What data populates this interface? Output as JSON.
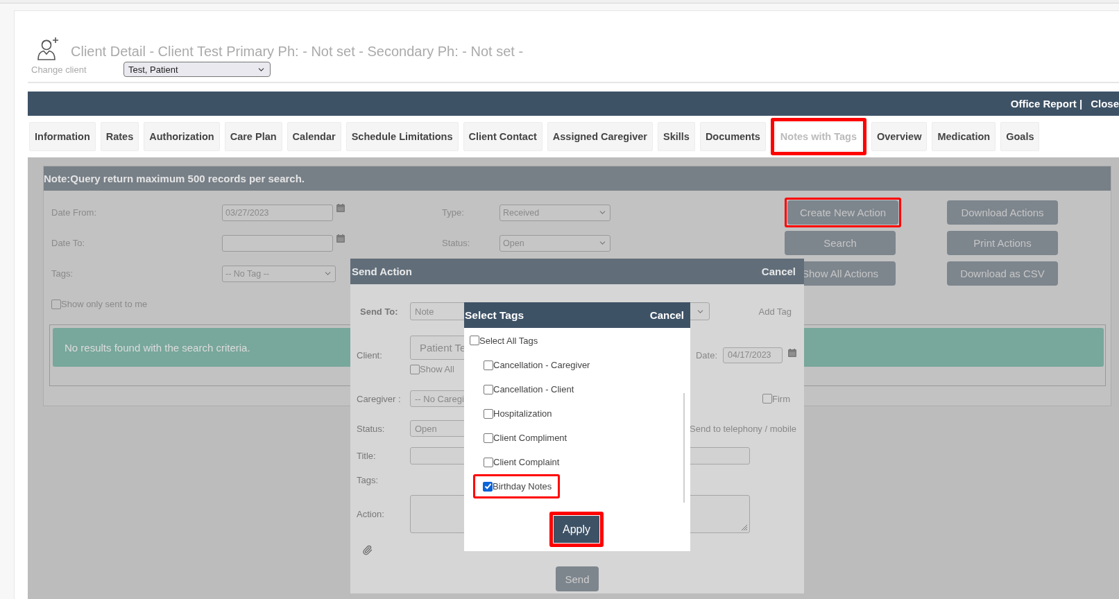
{
  "header": {
    "title": "Client Detail - Client Test Primary Ph: - Not set - Secondary Ph: - Not set -",
    "change_label": "Change client",
    "client_select": "Test, Patient"
  },
  "top_bar": {
    "links": [
      "Office Report |",
      "Close"
    ]
  },
  "tabs": [
    {
      "label": "Information",
      "selected": false,
      "highlighted": false
    },
    {
      "label": "Rates",
      "selected": false,
      "highlighted": false
    },
    {
      "label": "Authorization",
      "selected": false,
      "highlighted": false
    },
    {
      "label": "Care Plan",
      "selected": false,
      "highlighted": false
    },
    {
      "label": "Calendar",
      "selected": false,
      "highlighted": false
    },
    {
      "label": "Schedule Limitations",
      "selected": false,
      "highlighted": false
    },
    {
      "label": "Client Contact",
      "selected": false,
      "highlighted": false
    },
    {
      "label": "Assigned Caregiver",
      "selected": false,
      "highlighted": false
    },
    {
      "label": "Skills",
      "selected": false,
      "highlighted": false
    },
    {
      "label": "Documents",
      "selected": false,
      "highlighted": false
    },
    {
      "label": "Notes with Tags",
      "selected": true,
      "highlighted": true
    },
    {
      "label": "Overview",
      "selected": false,
      "highlighted": false
    },
    {
      "label": "Medication",
      "selected": false,
      "highlighted": false
    },
    {
      "label": "Goals",
      "selected": false,
      "highlighted": false
    }
  ],
  "search_panel": {
    "note": "Note:Query return maximum 500 records per search.",
    "rows": [
      {
        "label": "Date From:",
        "kind": "date",
        "value": "03/27/2023"
      },
      {
        "label": "Date To:",
        "kind": "date"
      },
      {
        "label": "Tags:",
        "kind": "select",
        "value": "-- No Tag --"
      }
    ],
    "filters": [
      {
        "label": "Type:",
        "value": "Received"
      },
      {
        "label": "Status:",
        "value": "Open"
      }
    ],
    "buttons": [
      {
        "label": "Create New Action",
        "highlighted": true
      },
      {
        "label": "Download Actions",
        "highlighted": false
      },
      {
        "label": "Search",
        "highlighted": false
      },
      {
        "label": "Print Actions",
        "highlighted": false
      },
      {
        "label": "Show All Actions",
        "highlighted": false
      },
      {
        "label": "Download as CSV",
        "highlighted": false
      }
    ],
    "only_mine": {
      "label": "Show only sent to me",
      "checked": false
    },
    "message": "No results found with the search criteria."
  },
  "send_action": {
    "title": "Send Action",
    "cancel": "Cancel",
    "send_to_label": "Send To:",
    "send_to": "Note",
    "add_tag": "Add Tag",
    "client_label": "Client:",
    "client": "Patient Te",
    "show_all": {
      "label": "Show All",
      "checked": false
    },
    "date_label": "Date:",
    "date": "04/17/2023",
    "caregiver_label": "Caregiver :",
    "caregiver": "-- No Caregi",
    "firm": {
      "label": "Firm",
      "checked": false
    },
    "status_label": "Status:",
    "status": "Open",
    "telephony_label": "Send to telephony / mobile",
    "title_label": "Title:",
    "tags_label": "Tags:",
    "action_label": "Action:",
    "send_button": "Send"
  },
  "select_tags": {
    "title": "Select Tags",
    "cancel": "Cancel",
    "select_all": {
      "label": "Select All Tags",
      "checked": false
    },
    "tags": [
      {
        "label": "Cancellation - Caregiver",
        "checked": false,
        "highlighted": false
      },
      {
        "label": "Cancellation - Client",
        "checked": false,
        "highlighted": false
      },
      {
        "label": "Hospitalization",
        "checked": false,
        "highlighted": false
      },
      {
        "label": "Client Compliment",
        "checked": false,
        "highlighted": false
      },
      {
        "label": "Client Complaint",
        "checked": false,
        "highlighted": false
      },
      {
        "label": "Birthday Notes",
        "checked": true,
        "highlighted": true
      }
    ],
    "apply": {
      "label": "Apply",
      "highlighted": true
    }
  }
}
